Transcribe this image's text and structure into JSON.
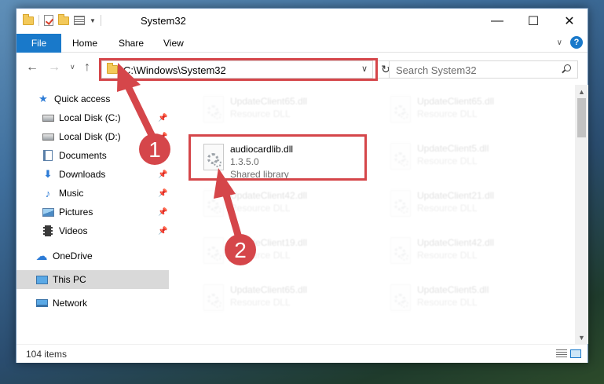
{
  "window": {
    "title": "System32",
    "controls": {
      "minimize": "—",
      "maximize": "☐",
      "close": "✕"
    }
  },
  "ribbon": {
    "tabs": [
      "File",
      "Home",
      "Share",
      "View"
    ],
    "help": "?"
  },
  "navigation": {
    "address": "C:\\Windows\\System32",
    "search_placeholder": "Search System32"
  },
  "sidebar": {
    "items": [
      {
        "label": "Quick access",
        "icon": "star-icon",
        "pinned": false
      },
      {
        "label": "Local Disk (C:)",
        "icon": "drive-icon",
        "pinned": true
      },
      {
        "label": "Local Disk (D:)",
        "icon": "drive-icon",
        "pinned": true
      },
      {
        "label": "Documents",
        "icon": "documents-icon",
        "pinned": true
      },
      {
        "label": "Downloads",
        "icon": "download-icon",
        "pinned": true
      },
      {
        "label": "Music",
        "icon": "music-icon",
        "pinned": true
      },
      {
        "label": "Pictures",
        "icon": "pictures-icon",
        "pinned": true
      },
      {
        "label": "Videos",
        "icon": "videos-icon",
        "pinned": true
      },
      {
        "label": "OneDrive",
        "icon": "cloud-icon",
        "pinned": false
      },
      {
        "label": "This PC",
        "icon": "pc-icon",
        "pinned": false,
        "selected": true
      },
      {
        "label": "Network",
        "icon": "network-icon",
        "pinned": false
      }
    ]
  },
  "files": {
    "highlighted": {
      "name": "audiocardlib.dll",
      "version": "1.3.5.0",
      "type": "Shared library"
    },
    "background": [
      {
        "name": "UpdateClient65.dll",
        "desc": "Resource DLL"
      },
      {
        "name": "UpdateClient65.dll",
        "desc": "Resource DLL"
      },
      {
        "name": "UpdateClient5.dll",
        "desc": "Resource DLL"
      },
      {
        "name": "UpdateClient42.dll",
        "desc": "Resource DLL"
      },
      {
        "name": "UpdateClient21.dll",
        "desc": "Resource DLL"
      },
      {
        "name": "UpdateClient19.dll",
        "desc": "Resource DLL"
      },
      {
        "name": "UpdateClient42.dll",
        "desc": "Resource DLL"
      },
      {
        "name": "UpdateClient65.dll",
        "desc": "Resource DLL"
      },
      {
        "name": "UpdateClient5.dll",
        "desc": "Resource DLL"
      }
    ]
  },
  "status": {
    "item_count": "104 items"
  },
  "callouts": {
    "one": "1",
    "two": "2",
    "color": "#d5464a"
  }
}
